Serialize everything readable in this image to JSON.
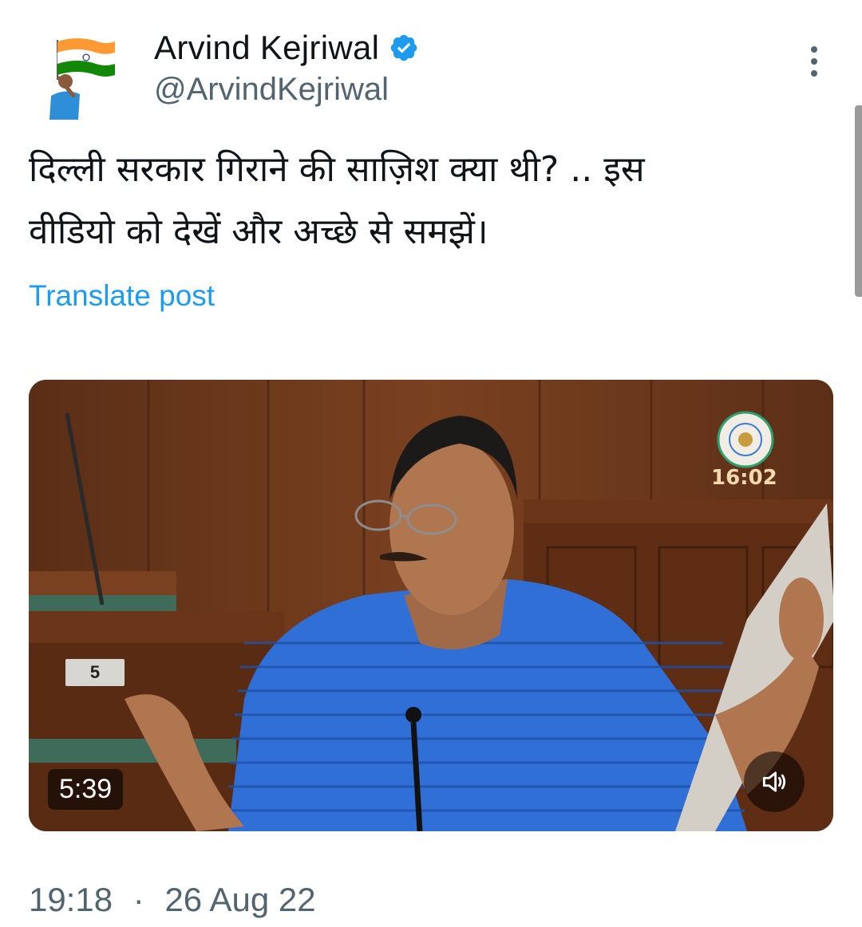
{
  "author": {
    "name": "Arvind Kejriwal",
    "handle": "@ArvindKejriwal",
    "verified": true,
    "avatar_icon": "avatar-with-flag-icon"
  },
  "menu_icon": "more-options-icon",
  "tweet": {
    "text_line1": "दिल्ली सरकार गिराने की साज़िश क्या थी? .. इस",
    "text_line2": "वीडियो को देखें और अच्छे से समझें।",
    "translate_label": "Translate post"
  },
  "video": {
    "duration": "5:39",
    "overlay_clock": "16:02",
    "seat_number": "5",
    "volume_icon": "speaker-icon"
  },
  "meta": {
    "time": "19:18",
    "separator": "·",
    "date": "26 Aug 22"
  },
  "colors": {
    "link": "#1d9bf0",
    "secondary_text": "#536471",
    "verified_badge": "#1d9bf0"
  }
}
